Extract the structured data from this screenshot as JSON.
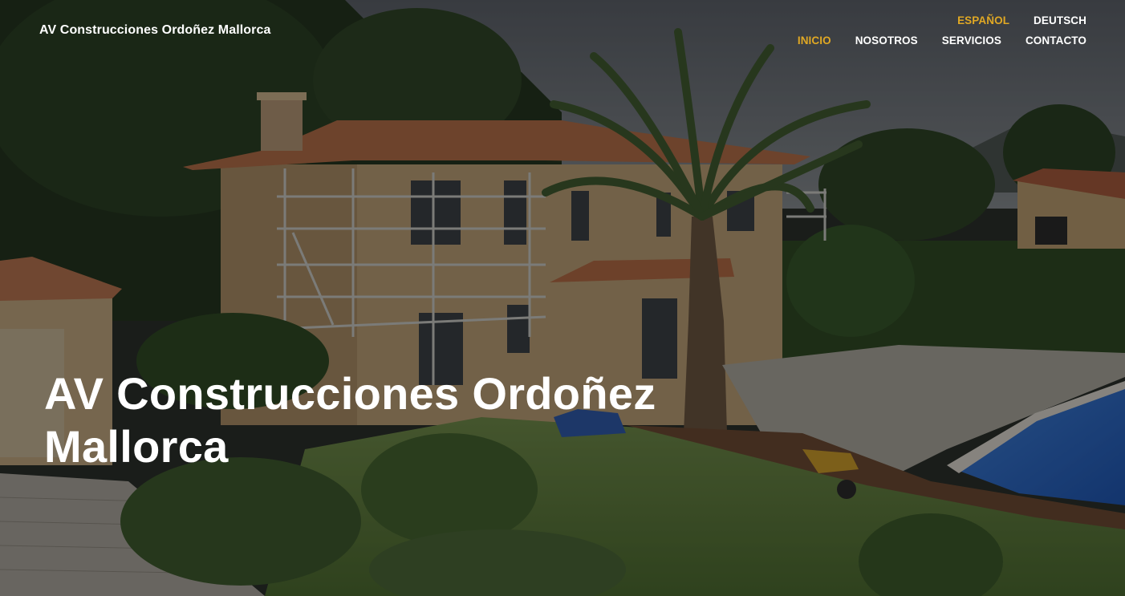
{
  "header": {
    "site_title": "AV Construcciones Ordoñez Mallorca",
    "languages": [
      {
        "label": "ESPAÑOL",
        "active": true
      },
      {
        "label": "DEUTSCH",
        "active": false
      }
    ],
    "nav": [
      {
        "label": "INICIO",
        "active": true
      },
      {
        "label": "NOSOTROS",
        "active": false
      },
      {
        "label": "SERVICIOS",
        "active": false
      },
      {
        "label": "CONTACTO",
        "active": false
      }
    ]
  },
  "hero": {
    "heading_line1": "AV Construcciones Ordoñez",
    "heading_line2": "Mallorca"
  },
  "colors": {
    "accent": "#e0a824",
    "nav_text": "#ffffff"
  }
}
